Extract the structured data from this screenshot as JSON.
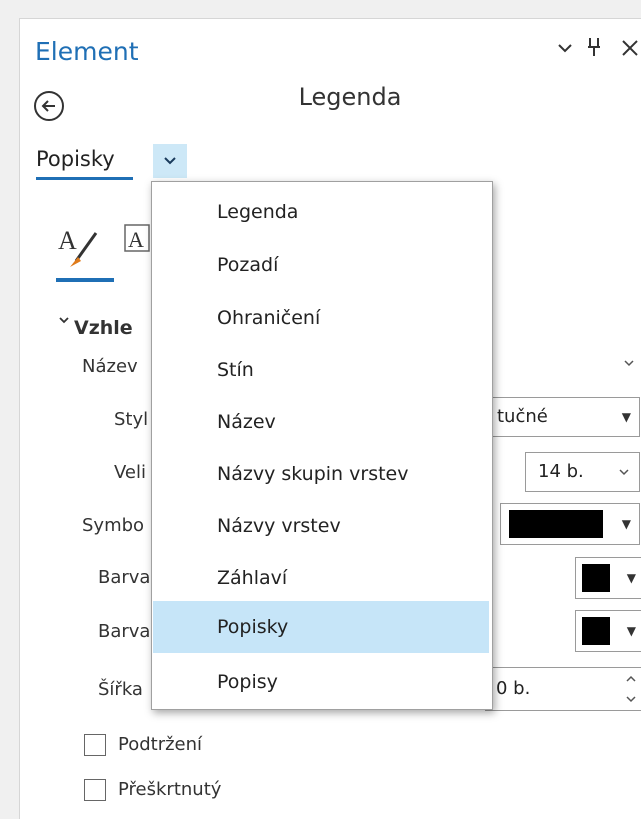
{
  "panel": {
    "title": "Element",
    "element_name": "Legenda",
    "selector_label": "Popisky"
  },
  "dropdown": {
    "items": [
      "Legenda",
      "Pozadí",
      "Ohraničení",
      "Stín",
      "Název",
      "Názvy skupin vrstev",
      "Názvy vrstev",
      "Záhlaví",
      "Popisky",
      "Popisy"
    ],
    "selected": "Popisky"
  },
  "properties": {
    "section": "Vzhle",
    "name_label": "Název",
    "style_label": "Styl",
    "style_value": "tučné",
    "size_label": "Veli",
    "size_value": "14 b.",
    "symbol_label": "Symbo",
    "color1_label": "Barva",
    "color2_label": "Barva",
    "width_label": "Šířka",
    "width_value": "0 b.",
    "underline_label": "Podtržení",
    "strikethrough_label": "Přeškrtnutý"
  },
  "colors": {
    "accent": "#1f6fb5",
    "selected_bg": "#c6e5f8",
    "swatch": "#000000"
  }
}
